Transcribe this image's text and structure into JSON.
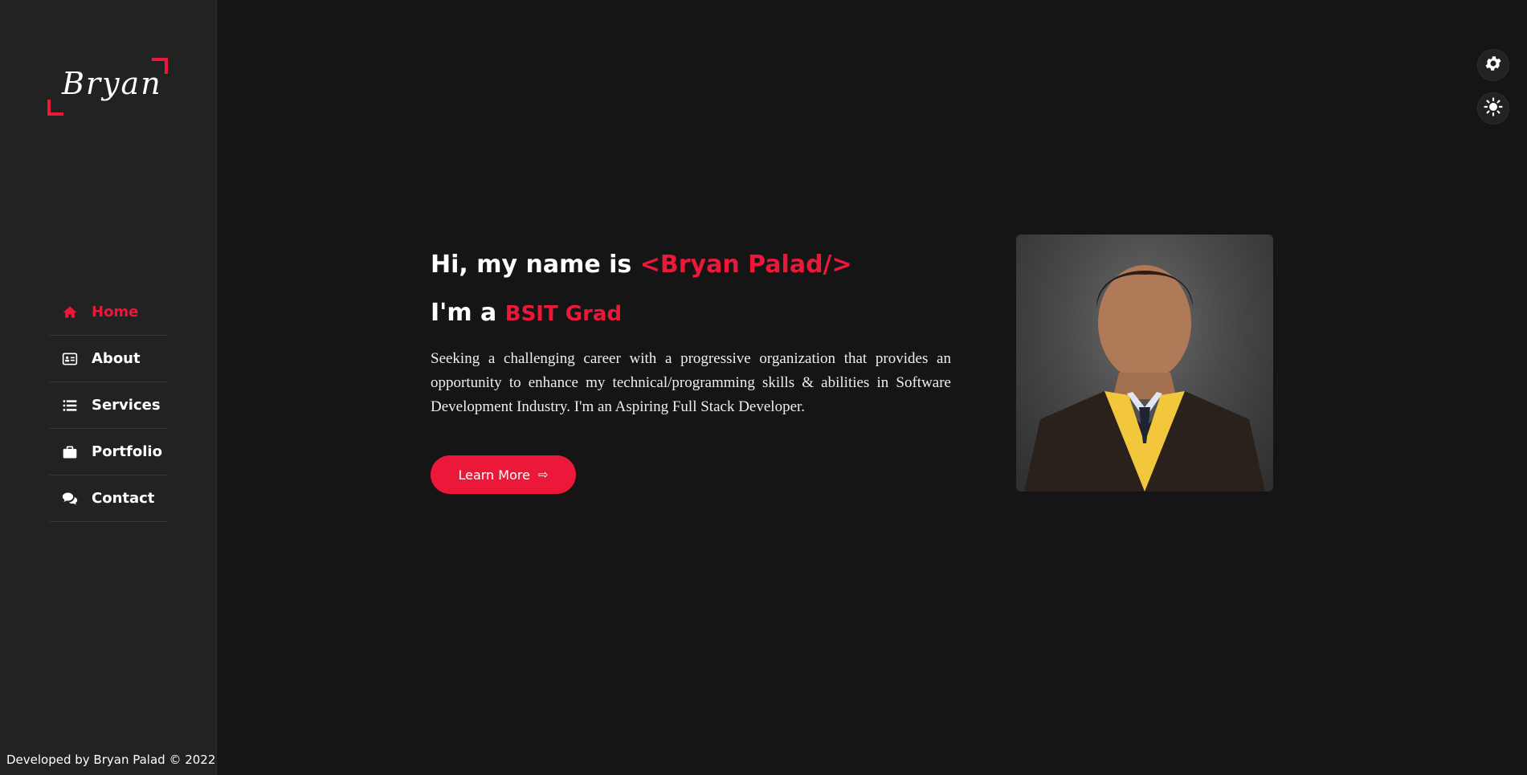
{
  "sidebar": {
    "logo": "Bryan",
    "nav": [
      {
        "label": "Home",
        "icon": "home-icon",
        "active": true
      },
      {
        "label": "About",
        "icon": "id-card-icon",
        "active": false
      },
      {
        "label": "Services",
        "icon": "list-icon",
        "active": false
      },
      {
        "label": "Portfolio",
        "icon": "briefcase-icon",
        "active": false
      },
      {
        "label": "Contact",
        "icon": "comments-icon",
        "active": false
      }
    ],
    "footer": "Developed by Bryan Palad © 2022"
  },
  "settings": {
    "icons": [
      "gear-icon",
      "sun-icon"
    ]
  },
  "hero": {
    "greeting": "Hi, my name is ",
    "name": "<Bryan Palad/>",
    "role_prefix": "I'm a ",
    "role": "BSIT Grad",
    "description": "Seeking a challenging career with a progressive organization that provides an opportunity to enhance my technical/programming skills & abilities in Software Development Industry. I'm an Aspiring Full Stack Developer.",
    "button_label": "Learn More",
    "button_icon": "arrow-right-icon"
  },
  "colors": {
    "accent": "#ec1839",
    "background": "#151515",
    "sidebar": "#222222",
    "text": "#ffffff"
  }
}
